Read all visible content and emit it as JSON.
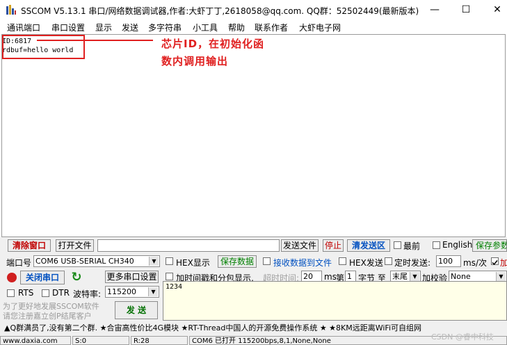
{
  "title": "SSCOM V5.13.1 串口/网络数据调试器,作者:大虾丁丁,2618058@qq.com. QQ群：52502449(最新版本)",
  "window": {
    "minimize": "—",
    "maximize": "☐",
    "close": "✕"
  },
  "menu": [
    "通讯端口",
    "串口设置",
    "显示",
    "发送",
    "多字符串",
    "小工具",
    "帮助",
    "联系作者",
    "大虾电子网"
  ],
  "receive": {
    "lines": [
      "ID:6817",
      "rdbuf=hello world"
    ]
  },
  "annotation": {
    "line1": "芯片ID，在初始化函",
    "line2": "数内调用输出"
  },
  "toolbar1": {
    "clear_window": "清除窗口",
    "open_file": "打开文件",
    "send_file": "发送文件",
    "stop": "停止",
    "clear_send": "清发送区",
    "latest": "最前",
    "english": "English",
    "save_params": "保存参数"
  },
  "port": {
    "label": "端口号",
    "value": "COM6 USB-SERIAL CH340",
    "more_ports": "更多串口设置"
  },
  "display": {
    "hex_display": "HEX显示",
    "save_data": "保存数据",
    "recv_to_file": "接收数据到文件",
    "hex_send": "HEX发送",
    "timed_send": "定时发送:",
    "timed_value": "100",
    "timed_unit": "ms/次",
    "add_crlf": "加"
  },
  "connection": {
    "close_port": "关闭串口",
    "timestamp": "加时间戳和分包显示,",
    "timeout_label": "超时时间:",
    "timeout_value": "20",
    "ms": "ms",
    "nth": "第",
    "byte_index": "1",
    "byte_unit": "字节 至",
    "end": "末尾",
    "checksum_label": "加校验",
    "checksum_value": "None"
  },
  "baud": {
    "rts": "RTS",
    "dtr": "DTR",
    "label": "波特率:",
    "value": "115200"
  },
  "send": {
    "text": "1234",
    "button": "发 送"
  },
  "ad": "为了更好地发展SSCOM软件\n请您注册嘉立创P结尾客户",
  "ticker": "▲Q群满员了,没有第二个群. ★合宙高性价比4G模块 ★RT-Thread中国人的开源免费操作系统 ★ ★8KM远距离WiFi可自组网",
  "status": {
    "website": "www.daxia.com",
    "sent": "S:0",
    "received": "R:28",
    "port_info": "COM6 已打开  115200bps,8,1,None,None"
  },
  "watermark": "CSDN @睿中科技",
  "colors": {
    "annotation": "#e02020",
    "send_bg": "#ffffe8"
  }
}
